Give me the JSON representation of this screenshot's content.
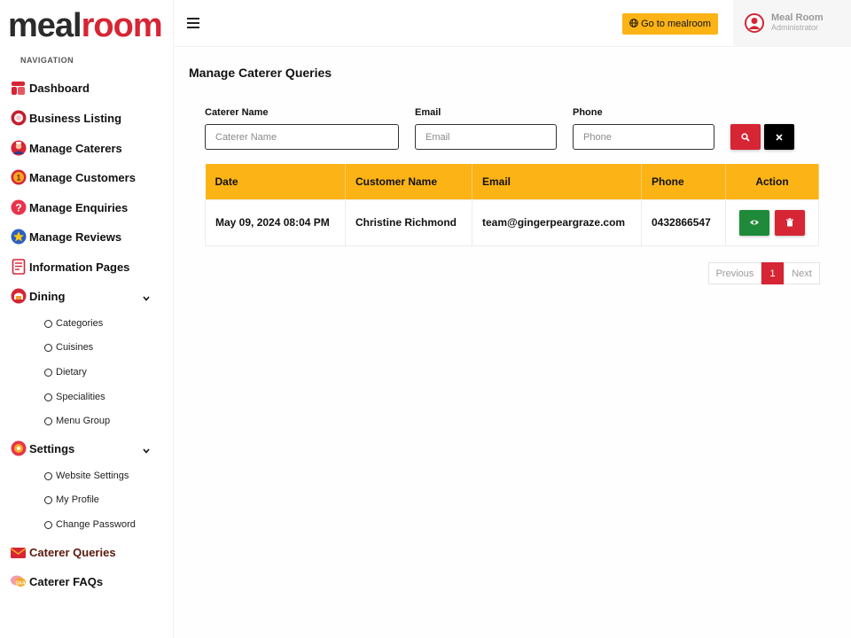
{
  "brand": {
    "part1": "meal",
    "part2": "room"
  },
  "sidebar": {
    "heading": "NAVIGATION",
    "items": [
      {
        "label": "Dashboard",
        "icon": "dashboard-icon"
      },
      {
        "label": "Business Listing",
        "icon": "plate-icon"
      },
      {
        "label": "Manage Caterers",
        "icon": "chef-icon"
      },
      {
        "label": "Manage Customers",
        "icon": "customer-icon"
      },
      {
        "label": "Manage Enquiries",
        "icon": "question-icon"
      },
      {
        "label": "Manage Reviews",
        "icon": "star-icon"
      },
      {
        "label": "Information Pages",
        "icon": "document-icon"
      },
      {
        "label": "Dining",
        "icon": "dining-icon"
      },
      {
        "label": "Settings",
        "icon": "gear-icon"
      },
      {
        "label": "Caterer Queries",
        "icon": "mail-icon"
      },
      {
        "label": "Caterer FAQs",
        "icon": "faq-icon"
      }
    ],
    "dining_sub": [
      "Categories",
      "Cuisines",
      "Dietary",
      "Specialities",
      "Menu Group"
    ],
    "settings_sub": [
      "Website Settings",
      "My Profile",
      "Change Password"
    ]
  },
  "header": {
    "goto_label": "Go to mealroom",
    "user_name": "Meal Room",
    "user_role": "Administrator"
  },
  "main": {
    "title": "Manage Caterer Queries",
    "filters": {
      "caterer_label": "Caterer Name",
      "caterer_placeholder": "Caterer Name",
      "email_label": "Email",
      "email_placeholder": "Email",
      "phone_label": "Phone",
      "phone_placeholder": "Phone"
    },
    "table": {
      "headers": [
        "Date",
        "Customer Name",
        "Email",
        "Phone",
        "Action"
      ],
      "rows": [
        {
          "date": "May 09, 2024 08:04 PM",
          "customer": "Christine Richmond",
          "email": "team@gingerpeargraze.com",
          "phone": "0432866547"
        }
      ]
    },
    "pagination": {
      "prev": "Previous",
      "current": "1",
      "next": "Next"
    }
  },
  "colors": {
    "accent": "#fbb316",
    "brand_red": "#d62534",
    "view_green": "#1e8a3a"
  }
}
